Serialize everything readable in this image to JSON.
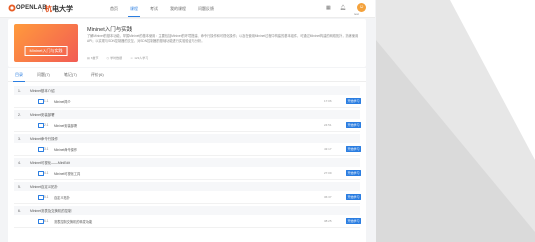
{
  "header": {
    "logo_text": "OPENLAB",
    "logo_cn_main": "杭",
    "logo_cn_rest": "电大学",
    "nav": [
      "首页",
      "课程",
      "考试",
      "我的课程",
      "问题反馈"
    ],
    "active_nav": 1,
    "icons": [
      "grid-icon",
      "bell-icon",
      "user-icon"
    ],
    "user_name": "test"
  },
  "course": {
    "cover_label": "Mininet入门与实践",
    "title": "Mininet入门与实践",
    "description": "了解Mininet的基本功能，掌握Mininet的基本使用：主要包括Mininet的环境搭建、命令行操作和可视化操作；以及在使用Mininet过程中构建的基本组件，可通过Mininet构建的网络拓扑，熟练使用API；以实现与SDN控制器的交互，对SDN控制器的基础功能进行实验验证与分析。",
    "meta": [
      {
        "icon": "chapter-icon",
        "text": "6章节"
      },
      {
        "icon": "clock-icon",
        "text": "学时数据"
      },
      {
        "icon": "user-count-icon",
        "text": "123人学习"
      }
    ]
  },
  "tabs": [
    "目录",
    "问题(7)",
    "笔记(7)",
    "评价(6)"
  ],
  "active_tab": 0,
  "chapters": [
    {
      "num": "1.",
      "title": "Mininet基本介绍",
      "section": {
        "idx": "1.1",
        "title": "Mininet简介",
        "duration": "17:06",
        "button": "开始学习"
      }
    },
    {
      "num": "2.",
      "title": "Mininet安装部署",
      "section": {
        "idx": "2.1",
        "title": "Mininet安装部署",
        "duration": "24:51",
        "button": "开始学习"
      }
    },
    {
      "num": "3.",
      "title": "Mininet命令行操作",
      "section": {
        "idx": "3.1",
        "title": "Mininet命令操作",
        "duration": "43:17",
        "button": "开始学习"
      }
    },
    {
      "num": "4.",
      "title": "Mininet可视化——MiniEdit",
      "section": {
        "idx": "4.1",
        "title": "Mininet可视化工具",
        "duration": "27:09",
        "button": "开始学习"
      }
    },
    {
      "num": "5.",
      "title": "Mininet自定义拓扑",
      "section": {
        "idx": "5.1",
        "title": "自定义拓扑",
        "duration": "36:37",
        "button": "开始学习"
      }
    },
    {
      "num": "6.",
      "title": "Mininet流表及交换机的控制",
      "section": {
        "idx": "6.1",
        "title": "流表控制交换机的转发功能",
        "duration": "38:25",
        "button": "开始学习"
      }
    }
  ]
}
